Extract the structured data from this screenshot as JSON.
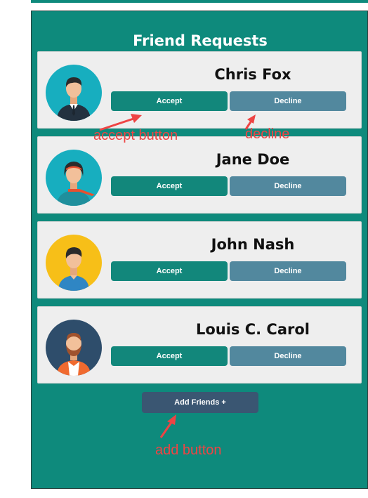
{
  "panel": {
    "title": "Friend Requests"
  },
  "requests": [
    {
      "name": "Chris Fox",
      "avatar": "man-suit-avatar-icon",
      "accept_label": "Accept",
      "decline_label": "Decline"
    },
    {
      "name": "Jane Doe",
      "avatar": "woman-avatar-icon",
      "accept_label": "Accept",
      "decline_label": "Decline"
    },
    {
      "name": "John Nash",
      "avatar": "man-casual-avatar-icon",
      "accept_label": "Accept",
      "decline_label": "Decline"
    },
    {
      "name": "Louis C. Carol",
      "avatar": "bearded-man-avatar-icon",
      "accept_label": "Accept",
      "decline_label": "Decline"
    }
  ],
  "add_button_label": "Add Friends +",
  "annotations": {
    "accept": "accept button",
    "decline": "decline",
    "add": "add button"
  },
  "colors": {
    "panel": "#0e8a7c",
    "card": "#eeeeee",
    "accept": "#12877b",
    "decline": "#52889e",
    "add": "#3a5672",
    "annotation": "#ee4444"
  }
}
